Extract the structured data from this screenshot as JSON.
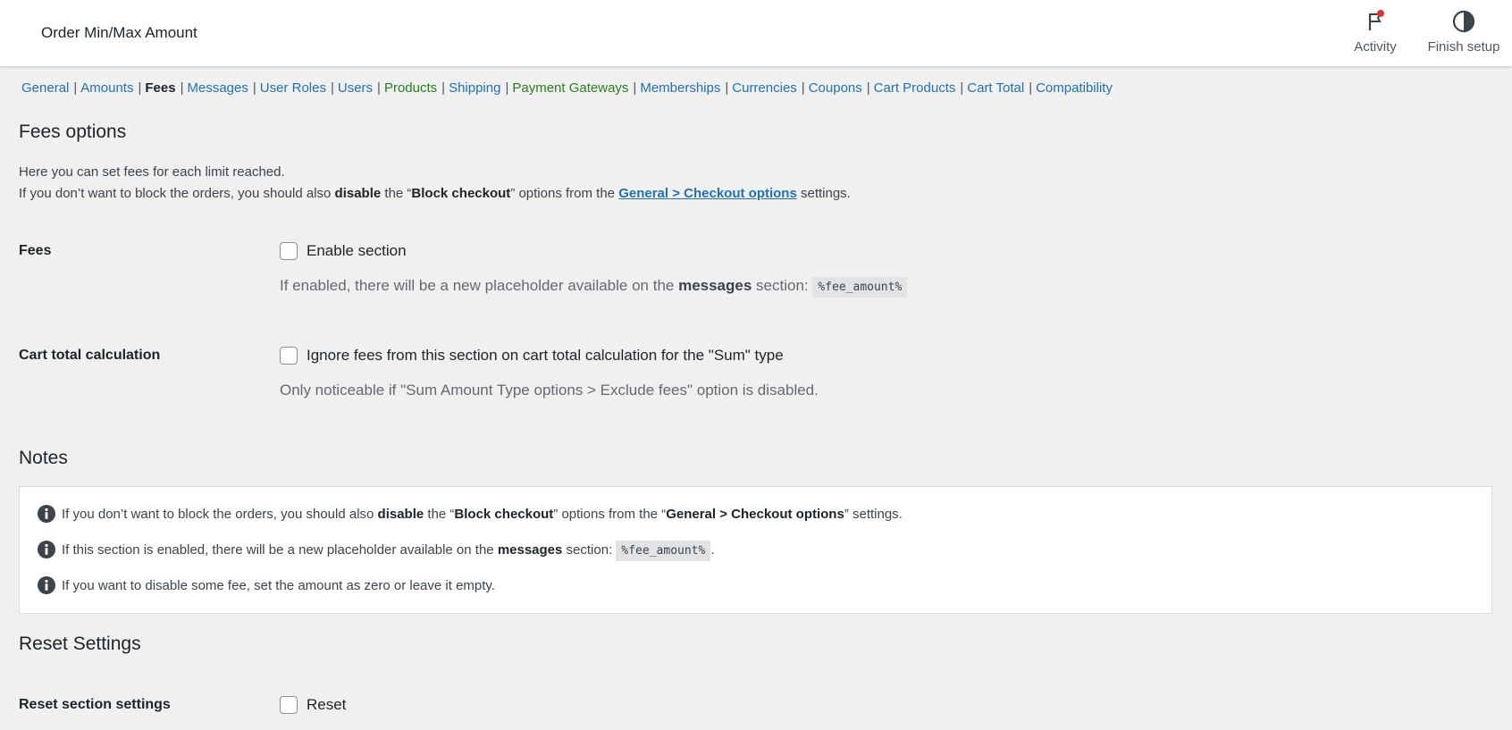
{
  "header": {
    "title": "Order Min/Max Amount",
    "activity_label": "Activity",
    "finish_label": "Finish setup"
  },
  "tabs": [
    {
      "label": "General"
    },
    {
      "label": "Amounts"
    },
    {
      "label": "Fees"
    },
    {
      "label": "Messages"
    },
    {
      "label": "User Roles"
    },
    {
      "label": "Users"
    },
    {
      "label": "Products"
    },
    {
      "label": "Shipping"
    },
    {
      "label": "Payment Gateways"
    },
    {
      "label": "Memberships"
    },
    {
      "label": "Currencies"
    },
    {
      "label": "Coupons"
    },
    {
      "label": "Cart Products"
    },
    {
      "label": "Cart Total"
    },
    {
      "label": "Compatibility"
    }
  ],
  "tab_separator": "|",
  "fees_options": {
    "heading": "Fees options",
    "line1": "Here you can set fees for each limit reached.",
    "line2_a": "If you don’t want to block the orders, you should also ",
    "line2_b": "disable",
    "line2_c": " the “",
    "line2_d": "Block checkout",
    "line2_e": "” options from the ",
    "line2_link": "General > Checkout options",
    "line2_f": " settings."
  },
  "fees": {
    "label": "Fees",
    "checkbox_label": "Enable section",
    "help_a": "If enabled, there will be a new placeholder available on the ",
    "help_b": "messages",
    "help_c": " section: ",
    "help_code": "%fee_amount%"
  },
  "cart_total": {
    "label": "Cart total calculation",
    "checkbox_label": "Ignore fees from this section on cart total calculation for the \"Sum\" type",
    "help": "Only noticeable if \"Sum Amount Type options > Exclude fees\" option is disabled."
  },
  "notes": {
    "heading": "Notes",
    "n1_a": "If you don’t want to block the orders, you should also ",
    "n1_b": "disable",
    "n1_c": " the “",
    "n1_d": "Block checkout",
    "n1_e": "” options from the “",
    "n1_f": "General > Checkout options",
    "n1_g": "” settings.",
    "n2_a": "If this section is enabled, there will be a new placeholder available on the ",
    "n2_b": "messages",
    "n2_c": " section: ",
    "n2_code": "%fee_amount%",
    "n2_d": ".",
    "n3": "If you want to disable some fee, set the amount as zero or leave it empty."
  },
  "reset": {
    "heading": "Reset Settings",
    "label": "Reset section settings",
    "checkbox_label": "Reset"
  },
  "colors": {
    "link": "#2271b1",
    "link_green": "#2a7d1f",
    "background": "#f0f0f1",
    "notification_dot": "#d63638"
  }
}
